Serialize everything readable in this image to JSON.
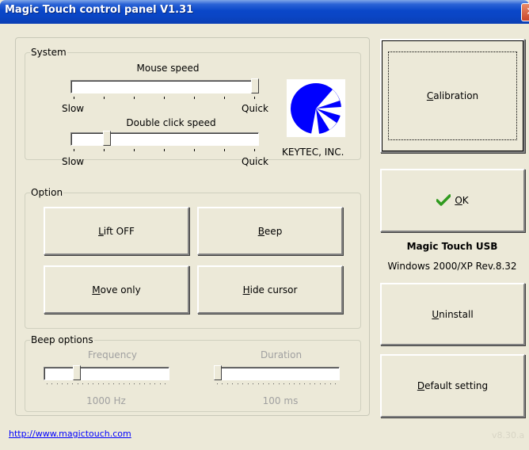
{
  "window": {
    "title": "Magic Touch control panel V1.31",
    "close_glyph": "✕"
  },
  "system": {
    "legend": "System",
    "mouse_speed": {
      "label": "Mouse speed",
      "min_label": "Slow",
      "max_label": "Quick",
      "level": 1.0
    },
    "double_click_speed": {
      "label": "Double click speed",
      "min_label": "Slow",
      "max_label": "Quick",
      "level": 0.18
    },
    "logo_icon": "keytec-logo-icon",
    "brand": "KEYTEC, INC."
  },
  "option": {
    "legend": "Option",
    "buttons": [
      {
        "mnemonic": "L",
        "rest": "ift OFF"
      },
      {
        "mnemonic": "B",
        "rest": "eep"
      },
      {
        "mnemonic": "M",
        "rest": "ove only"
      },
      {
        "mnemonic": "H",
        "rest": "ide cursor"
      }
    ]
  },
  "beep_options": {
    "legend": "Beep options",
    "frequency": {
      "label": "Frequency",
      "value": "1000 Hz",
      "level": 0.25
    },
    "duration": {
      "label": "Duration",
      "value": "100 ms",
      "level": 0.0
    }
  },
  "link": "http://www.magictouch.com",
  "version_note": "v8.30.a",
  "right_panel": {
    "calibration": {
      "mnemonic": "C",
      "rest": "alibration"
    },
    "ok": {
      "mnemonic": "O",
      "rest": "K",
      "icon": "checkmark-icon"
    },
    "product_name": "Magic Touch USB",
    "product_rev": "Windows 2000/XP Rev.8.32",
    "uninstall": {
      "mnemonic": "U",
      "rest": "ninstall"
    },
    "default_setting": {
      "mnemonic": "D",
      "rest": "efault setting"
    }
  },
  "colors": {
    "titlebar": "#0a47c9",
    "link": "#0000ff",
    "logo_blue": "#0000ff",
    "check_green": "#2f9a1e"
  }
}
